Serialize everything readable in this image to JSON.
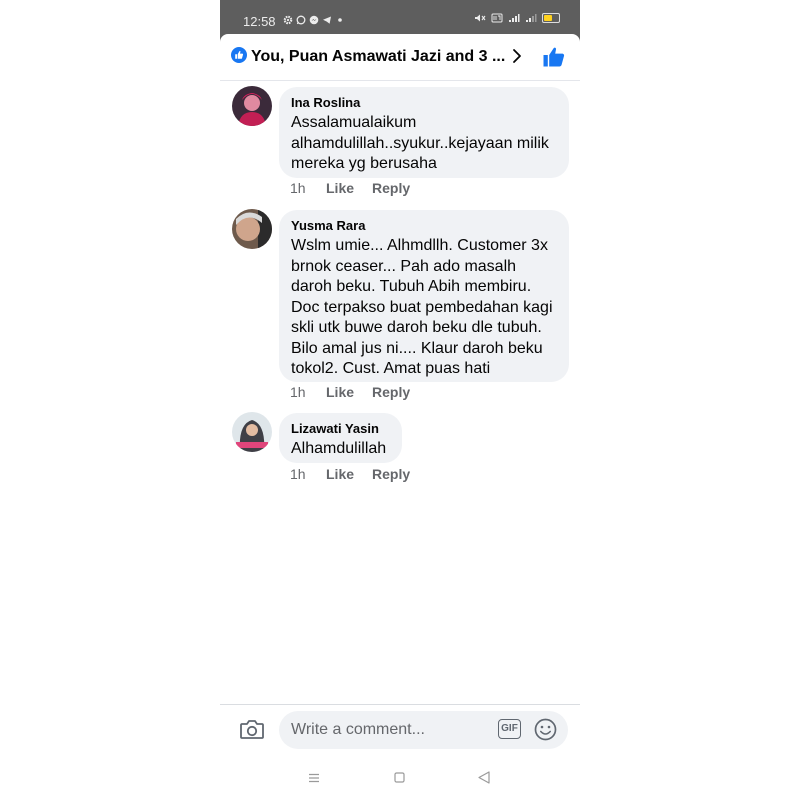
{
  "status_bar": {
    "time": "12:58",
    "left_icons": [
      "gear-icon",
      "whatsapp-icon",
      "messenger-icon",
      "telegram-icon",
      "dot-icon"
    ],
    "right_icons": [
      "mute-icon",
      "volte-icon",
      "signal-icon",
      "signal-icon",
      "battery-icon"
    ],
    "battery_level": 0.55,
    "battery_color": "#ffd21f"
  },
  "header": {
    "title": "You, Puan Asmawati Jazi and 3 ...",
    "reaction_icon": "like-icon",
    "chevron_icon": "chevron-right-icon",
    "action_icon": "thumbs-up-icon",
    "accent_color": "#1877f2"
  },
  "comments": [
    {
      "author": "Ina Roslina",
      "lines": [
        "Assalamualaikum",
        "alhamdulillah..syukur..kejayaan milik",
        "mereka yg berusaha"
      ],
      "time": "1h",
      "like_label": "Like",
      "reply_label": "Reply"
    },
    {
      "author": "Yusma Rara",
      "lines": [
        "Wslm umie... Alhmdllh. Customer 3x",
        "brnok ceaser... Pah ado masalh",
        "daroh beku. Tubuh Abih membiru.",
        "Doc terpakso buat pembedahan kagi",
        "skli utk buwe daroh beku dle tubuh.",
        "Bilo amal jus ni.... Klaur daroh beku",
        "tokol2. Cust. Amat puas hati"
      ],
      "time": "1h",
      "like_label": "Like",
      "reply_label": "Reply"
    },
    {
      "author": "Lizawati Yasin",
      "lines": [
        "Alhamdulillah"
      ],
      "time": "1h",
      "like_label": "Like",
      "reply_label": "Reply"
    }
  ],
  "composer": {
    "placeholder": "Write a comment...",
    "gif_label": "GIF",
    "camera_icon": "camera-icon",
    "emoji_icon": "emoji-icon"
  },
  "nav_bar": {
    "icons": [
      "menu-icon",
      "home-square-icon",
      "back-triangle-icon"
    ]
  }
}
